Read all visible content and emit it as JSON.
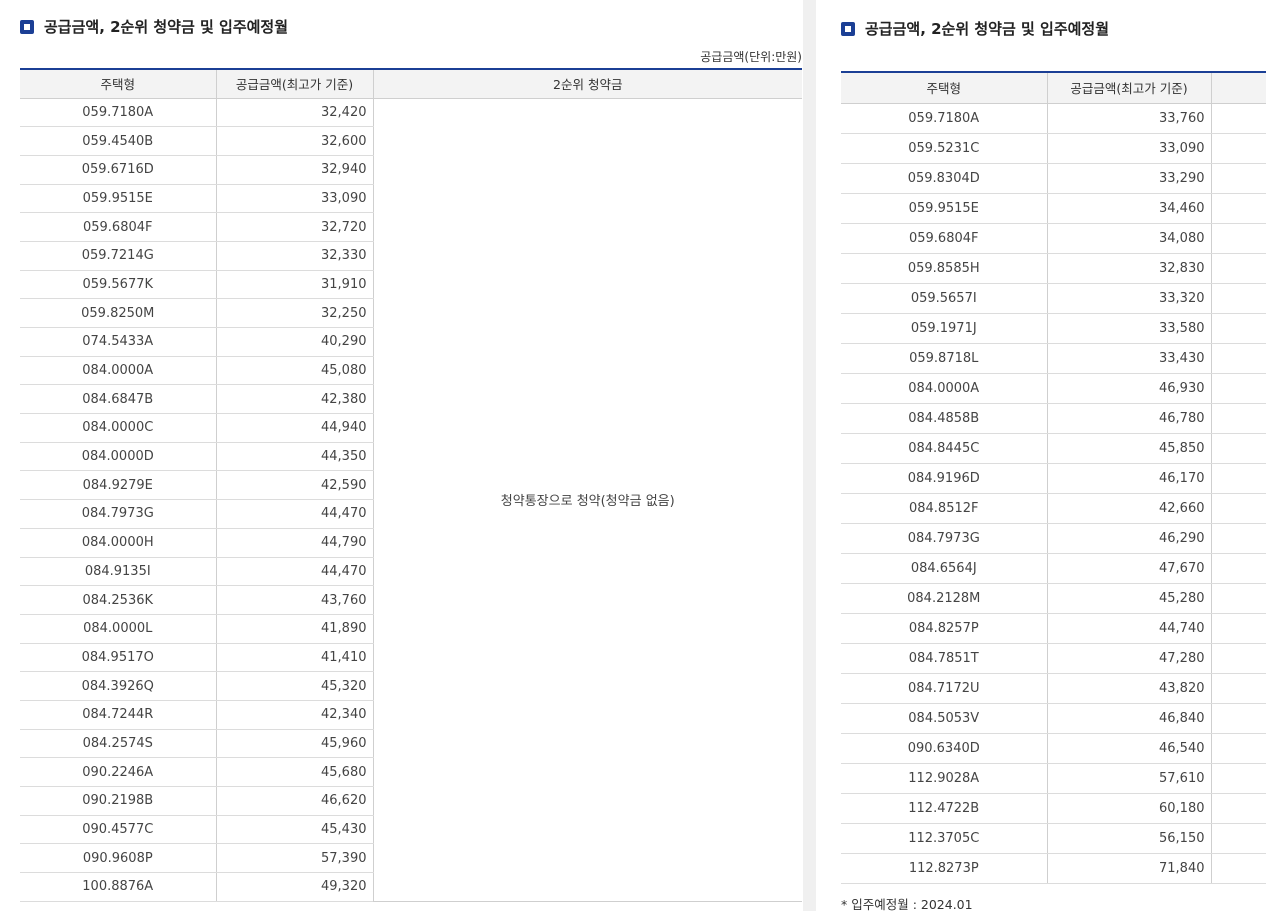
{
  "colors": {
    "accent": "#1b3f95",
    "header_bg": "#f3f3f3",
    "divider": "#f0f0f0"
  },
  "left": {
    "title": "공급금액, 2순위 청약금 및 입주예정월",
    "unit": "공급금액(단위:만원)",
    "headers": [
      "주택형",
      "공급금액(최고가 기준)",
      "2순위 청약금"
    ],
    "merged_cell": "청약통장으로 청약(청약금 없음)",
    "rows": [
      [
        "059.7180A",
        "32,420"
      ],
      [
        "059.4540B",
        "32,600"
      ],
      [
        "059.6716D",
        "32,940"
      ],
      [
        "059.9515E",
        "33,090"
      ],
      [
        "059.6804F",
        "32,720"
      ],
      [
        "059.7214G",
        "32,330"
      ],
      [
        "059.5677K",
        "31,910"
      ],
      [
        "059.8250M",
        "32,250"
      ],
      [
        "074.5433A",
        "40,290"
      ],
      [
        "084.0000A",
        "45,080"
      ],
      [
        "084.6847B",
        "42,380"
      ],
      [
        "084.0000C",
        "44,940"
      ],
      [
        "084.0000D",
        "44,350"
      ],
      [
        "084.9279E",
        "42,590"
      ],
      [
        "084.7973G",
        "44,470"
      ],
      [
        "084.0000H",
        "44,790"
      ],
      [
        "084.9135I",
        "44,470"
      ],
      [
        "084.2536K",
        "43,760"
      ],
      [
        "084.0000L",
        "41,890"
      ],
      [
        "084.9517O",
        "41,410"
      ],
      [
        "084.3926Q",
        "45,320"
      ],
      [
        "084.7244R",
        "42,340"
      ],
      [
        "084.2574S",
        "45,960"
      ],
      [
        "090.2246A",
        "45,680"
      ],
      [
        "090.2198B",
        "46,620"
      ],
      [
        "090.4577C",
        "45,430"
      ],
      [
        "090.9608P",
        "57,390"
      ],
      [
        "100.8876A",
        "49,320"
      ]
    ]
  },
  "right": {
    "title": "공급금액, 2순위 청약금 및 입주예정월",
    "headers": [
      "주택형",
      "공급금액(최고가 기준)",
      ""
    ],
    "rows": [
      [
        "059.7180A",
        "33,760"
      ],
      [
        "059.5231C",
        "33,090"
      ],
      [
        "059.8304D",
        "33,290"
      ],
      [
        "059.9515E",
        "34,460"
      ],
      [
        "059.6804F",
        "34,080"
      ],
      [
        "059.8585H",
        "32,830"
      ],
      [
        "059.5657I",
        "33,320"
      ],
      [
        "059.1971J",
        "33,580"
      ],
      [
        "059.8718L",
        "33,430"
      ],
      [
        "084.0000A",
        "46,930"
      ],
      [
        "084.4858B",
        "46,780"
      ],
      [
        "084.8445C",
        "45,850"
      ],
      [
        "084.9196D",
        "46,170"
      ],
      [
        "084.8512F",
        "42,660"
      ],
      [
        "084.7973G",
        "46,290"
      ],
      [
        "084.6564J",
        "47,670"
      ],
      [
        "084.2128M",
        "45,280"
      ],
      [
        "084.8257P",
        "44,740"
      ],
      [
        "084.7851T",
        "47,280"
      ],
      [
        "084.7172U",
        "43,820"
      ],
      [
        "084.5053V",
        "46,840"
      ],
      [
        "090.6340D",
        "46,540"
      ],
      [
        "112.9028A",
        "57,610"
      ],
      [
        "112.4722B",
        "60,180"
      ],
      [
        "112.3705C",
        "56,150"
      ],
      [
        "112.8273P",
        "71,840"
      ]
    ],
    "footnote": "* 입주예정월 : 2024.01"
  }
}
